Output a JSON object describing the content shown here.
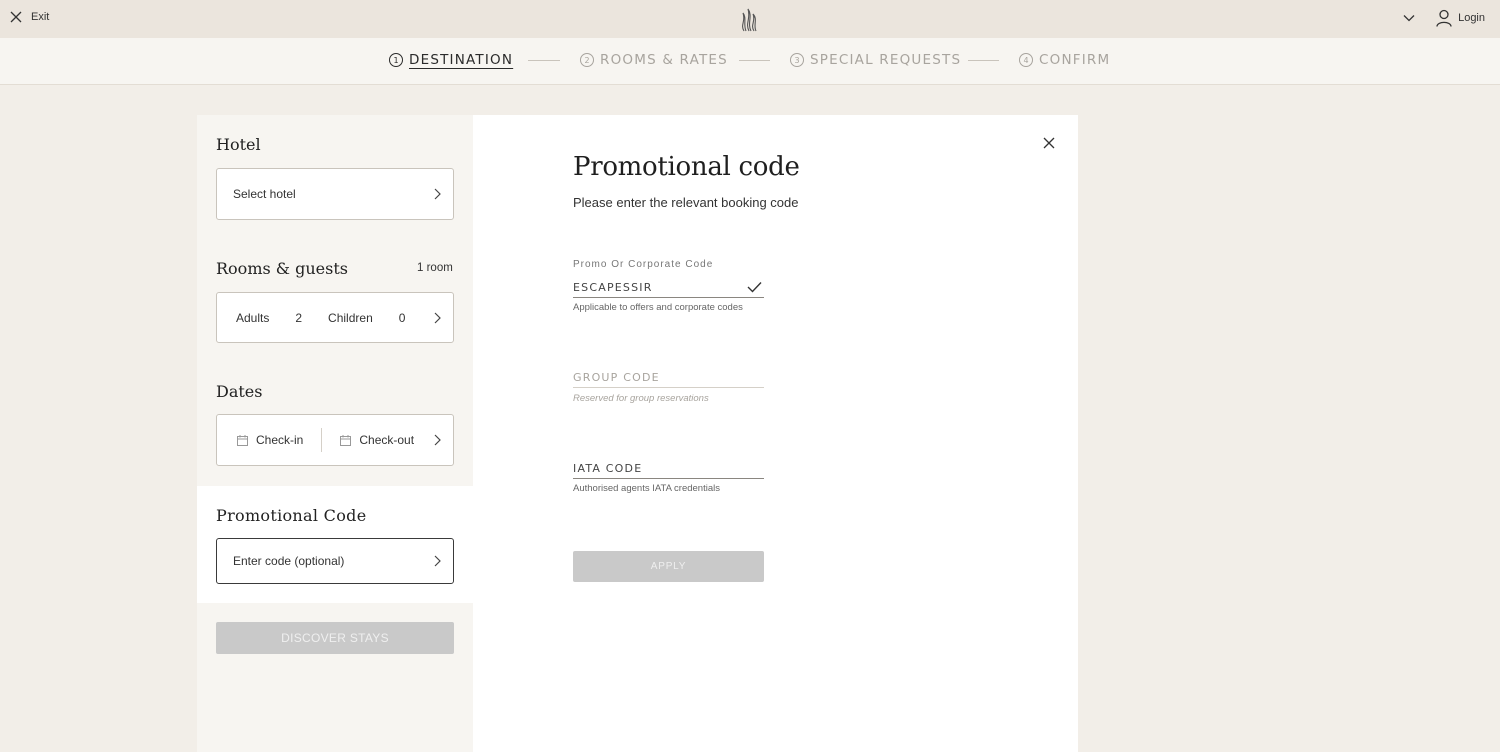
{
  "topbar": {
    "exit_label": "Exit",
    "login_label": "Login"
  },
  "steps": [
    {
      "num": "1",
      "label": "DESTINATION",
      "active": true
    },
    {
      "num": "2",
      "label": "ROOMS & RATES",
      "active": false
    },
    {
      "num": "3",
      "label": "SPECIAL REQUESTS",
      "active": false
    },
    {
      "num": "4",
      "label": "CONFIRM",
      "active": false
    }
  ],
  "sidebar": {
    "hotel_title": "Hotel",
    "hotel_placeholder": "Select hotel",
    "rooms_title": "Rooms & guests",
    "rooms_count": "1 room",
    "adults_label": "Adults",
    "adults_value": "2",
    "children_label": "Children",
    "children_value": "0",
    "dates_title": "Dates",
    "checkin_label": "Check-in",
    "checkout_label": "Check-out",
    "promo_title": "Promotional Code",
    "promo_placeholder": "Enter code (optional)",
    "discover_label": "DISCOVER STAYS"
  },
  "modal": {
    "title": "Promotional code",
    "subtitle": "Please enter the relevant booking code",
    "promo_field_label": "Promo Or Corporate Code",
    "promo_value": "ESCAPESSIR",
    "promo_help": "Applicable to offers and corporate codes",
    "group_placeholder": "GROUP CODE",
    "group_help": "Reserved for group reservations",
    "iata_value": "IATA CODE",
    "iata_help": "Authorised agents IATA credentials",
    "apply_label": "APPLY"
  },
  "icons": {
    "exit": "close-icon",
    "logo": "flame-logo-icon",
    "menu": "chevron-down-icon",
    "user": "user-icon",
    "arrow": "chevron-right-icon",
    "calendar": "calendar-icon",
    "check": "checkmark-icon",
    "close": "close-icon"
  },
  "colors": {
    "background": "#f2eee8",
    "topbar": "#ebe5dd",
    "panel": "#f7f5f1",
    "disabled_button": "#c9c9c9",
    "muted_text": "#a8a49e"
  }
}
